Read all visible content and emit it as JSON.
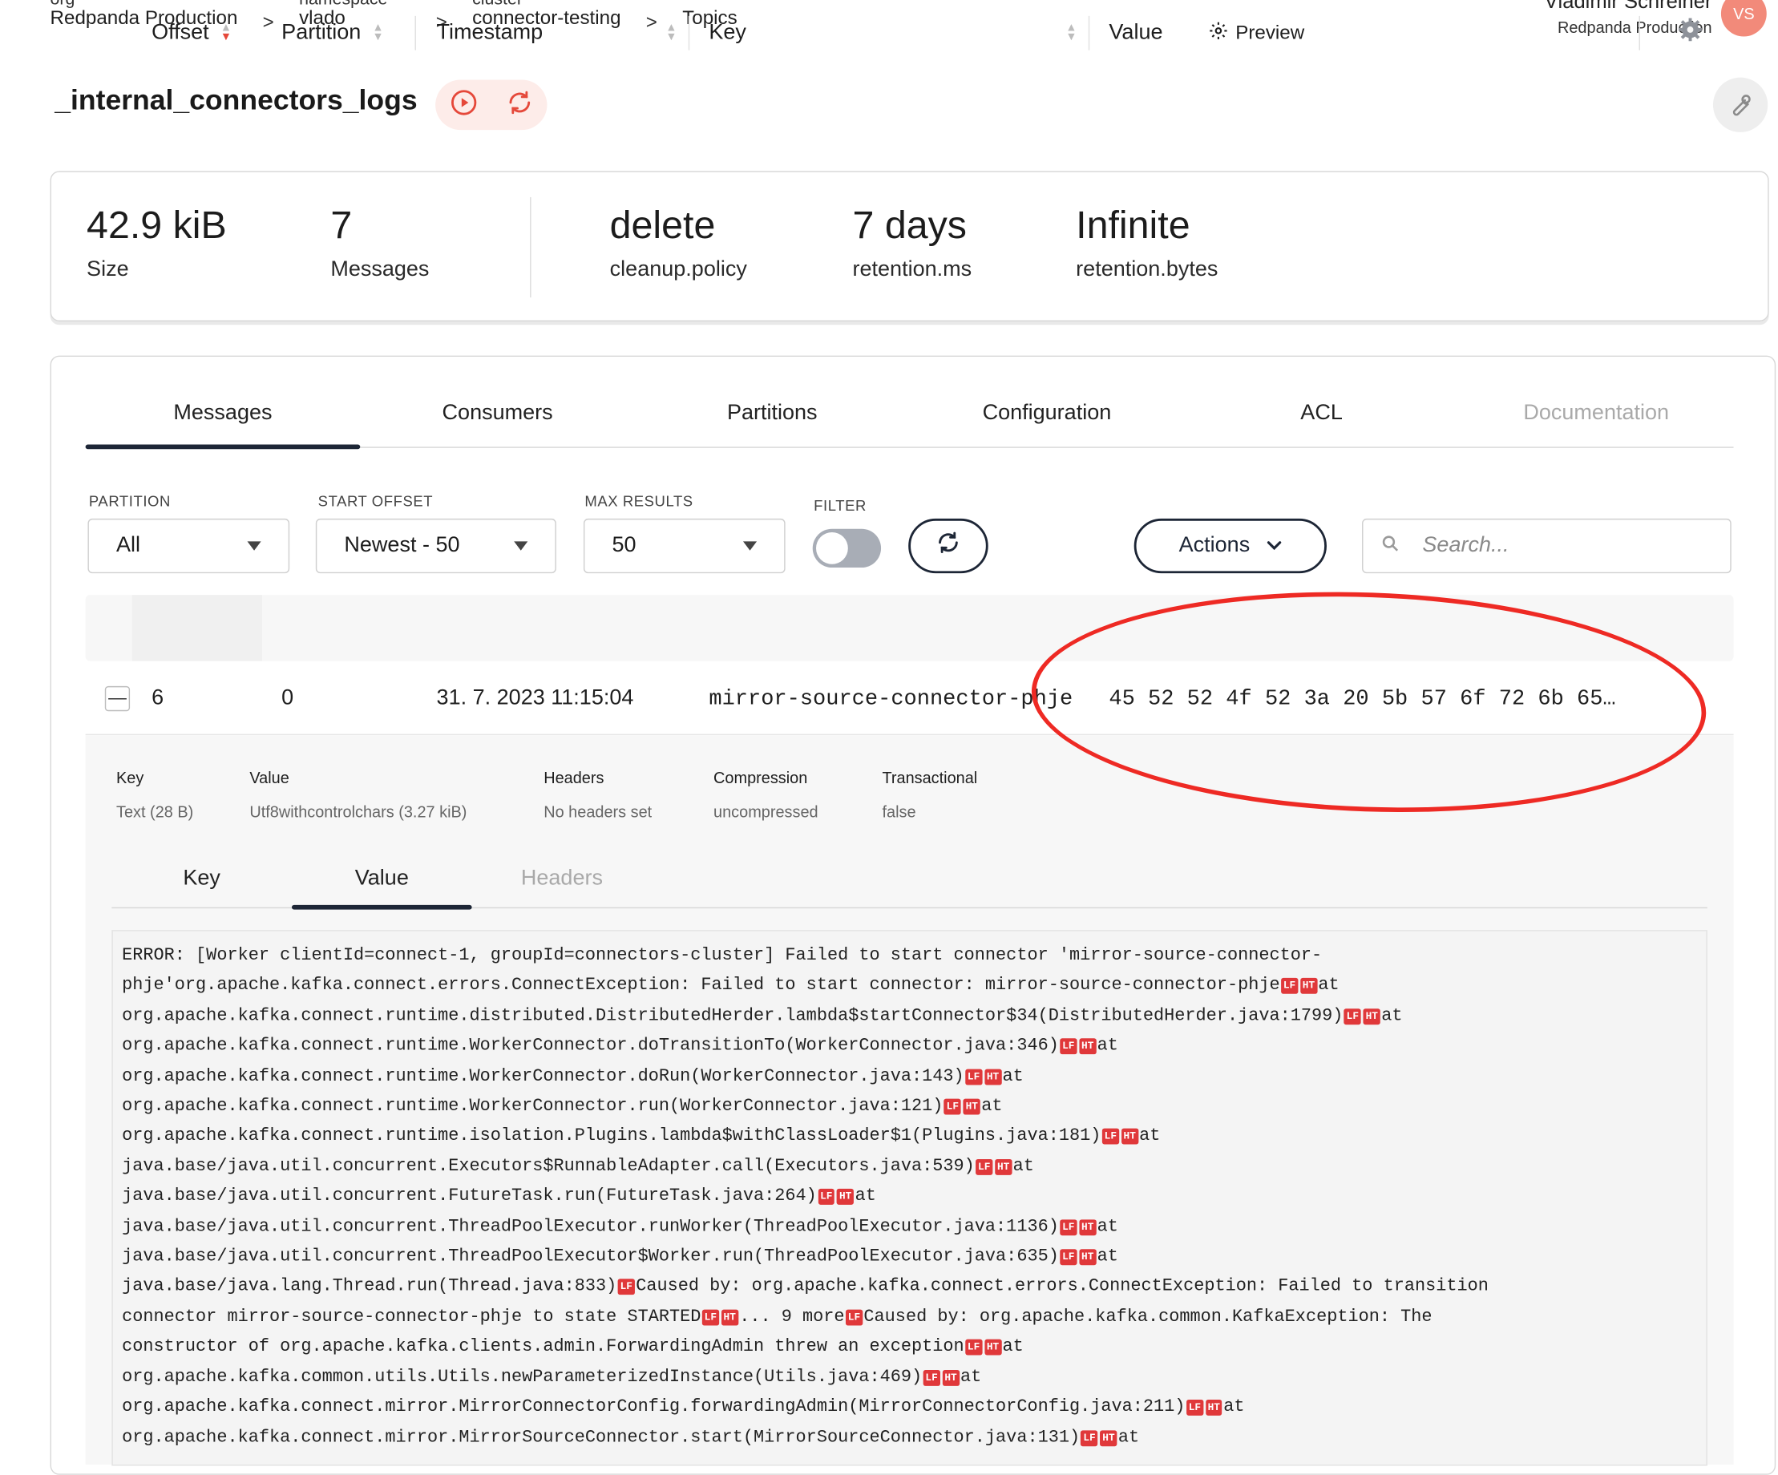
{
  "breadcrumb": [
    {
      "label": "org",
      "value": "Redpanda Production"
    },
    {
      "label": "namespace",
      "value": "vlado"
    },
    {
      "label": "cluster",
      "value": "connector-testing"
    },
    {
      "label": "",
      "value": "Topics"
    }
  ],
  "breadcrumb_separator": ">",
  "user": {
    "name": "Vladimir Schreiner",
    "org": "Redpanda Production",
    "initials": "VS"
  },
  "topic": {
    "title": "_internal_connectors_logs"
  },
  "icons": {
    "play": "play-circle-icon",
    "refresh": "refresh-icon",
    "wrench": "wrench-icon",
    "search": "search-icon",
    "gear": "gear-icon",
    "caret": "caret-down-icon"
  },
  "stats": [
    {
      "value": "42.9 kiB",
      "caption": "Size"
    },
    {
      "value": "7",
      "caption": "Messages"
    },
    {
      "value": "delete",
      "caption": "cleanup.policy"
    },
    {
      "value": "7 days",
      "caption": "retention.ms"
    },
    {
      "value": "Infinite",
      "caption": "retention.bytes"
    }
  ],
  "tabs": [
    "Messages",
    "Consumers",
    "Partitions",
    "Configuration",
    "ACL",
    "Documentation"
  ],
  "filters": {
    "partition": {
      "label": "PARTITION",
      "value": "All"
    },
    "start_offset": {
      "label": "START OFFSET",
      "value": "Newest - 50"
    },
    "max_results": {
      "label": "MAX RESULTS",
      "value": "50"
    },
    "filter": {
      "label": "FILTER"
    },
    "actions_label": "Actions",
    "search_placeholder": "Search..."
  },
  "table": {
    "headers": [
      "Offset",
      "Partition",
      "Timestamp",
      "Key",
      "Value"
    ],
    "preview_label": "Preview",
    "row": {
      "offset": "6",
      "partition": "0",
      "timestamp": "31. 7. 2023 11:15:04",
      "key": "mirror-source-connector-phje",
      "value": "45 52 52 4f 52 3a 20 5b 57 6f 72 6b 65…"
    }
  },
  "message_meta": [
    {
      "label": "Key",
      "value": "Text (28 B)"
    },
    {
      "label": "Value",
      "value": "Utf8withcontrolchars (3.27 kiB)"
    },
    {
      "label": "Headers",
      "value": "No headers set"
    },
    {
      "label": "Compression",
      "value": "uncompressed"
    },
    {
      "label": "Transactional",
      "value": "false"
    }
  ],
  "subtabs": [
    "Key",
    "Value",
    "Headers"
  ],
  "control_chars": {
    "lf": "LF",
    "ht": "HT"
  },
  "value_lines": [
    [
      [
        "t",
        "ERROR: [Worker clientId=connect-1, groupId=connectors-cluster] Failed to start connector 'mirror-source-connector-"
      ]
    ],
    [
      [
        "t",
        "phje'org.apache.kafka.connect.errors.ConnectException: Failed to start connector: mirror-source-connector-phje"
      ],
      [
        "c",
        "LF"
      ],
      [
        "c",
        "HT"
      ],
      [
        "t",
        "at"
      ]
    ],
    [
      [
        "t",
        "org.apache.kafka.connect.runtime.distributed.DistributedHerder.lambda$startConnector$34(DistributedHerder.java:1799)"
      ],
      [
        "c",
        "LF"
      ],
      [
        "c",
        "HT"
      ],
      [
        "t",
        "at"
      ]
    ],
    [
      [
        "t",
        "org.apache.kafka.connect.runtime.WorkerConnector.doTransitionTo(WorkerConnector.java:346)"
      ],
      [
        "c",
        "LF"
      ],
      [
        "c",
        "HT"
      ],
      [
        "t",
        "at"
      ]
    ],
    [
      [
        "t",
        "org.apache.kafka.connect.runtime.WorkerConnector.doRun(WorkerConnector.java:143)"
      ],
      [
        "c",
        "LF"
      ],
      [
        "c",
        "HT"
      ],
      [
        "t",
        "at"
      ]
    ],
    [
      [
        "t",
        "org.apache.kafka.connect.runtime.WorkerConnector.run(WorkerConnector.java:121)"
      ],
      [
        "c",
        "LF"
      ],
      [
        "c",
        "HT"
      ],
      [
        "t",
        "at"
      ]
    ],
    [
      [
        "t",
        "org.apache.kafka.connect.runtime.isolation.Plugins.lambda$withClassLoader$1(Plugins.java:181)"
      ],
      [
        "c",
        "LF"
      ],
      [
        "c",
        "HT"
      ],
      [
        "t",
        "at"
      ]
    ],
    [
      [
        "t",
        "java.base/java.util.concurrent.Executors$RunnableAdapter.call(Executors.java:539)"
      ],
      [
        "c",
        "LF"
      ],
      [
        "c",
        "HT"
      ],
      [
        "t",
        "at"
      ]
    ],
    [
      [
        "t",
        "java.base/java.util.concurrent.FutureTask.run(FutureTask.java:264)"
      ],
      [
        "c",
        "LF"
      ],
      [
        "c",
        "HT"
      ],
      [
        "t",
        "at"
      ]
    ],
    [
      [
        "t",
        "java.base/java.util.concurrent.ThreadPoolExecutor.runWorker(ThreadPoolExecutor.java:1136)"
      ],
      [
        "c",
        "LF"
      ],
      [
        "c",
        "HT"
      ],
      [
        "t",
        "at"
      ]
    ],
    [
      [
        "t",
        "java.base/java.util.concurrent.ThreadPoolExecutor$Worker.run(ThreadPoolExecutor.java:635)"
      ],
      [
        "c",
        "LF"
      ],
      [
        "c",
        "HT"
      ],
      [
        "t",
        "at"
      ]
    ],
    [
      [
        "t",
        "java.base/java.lang.Thread.run(Thread.java:833)"
      ],
      [
        "c",
        "LF"
      ],
      [
        "t",
        "Caused by: org.apache.kafka.connect.errors.ConnectException: Failed to transition"
      ]
    ],
    [
      [
        "t",
        "connector mirror-source-connector-phje to state STARTED"
      ],
      [
        "c",
        "LF"
      ],
      [
        "c",
        "HT"
      ],
      [
        "t",
        "... 9 more"
      ],
      [
        "c",
        "LF"
      ],
      [
        "t",
        "Caused by: org.apache.kafka.common.KafkaException: The"
      ]
    ],
    [
      [
        "t",
        "constructor of org.apache.kafka.clients.admin.ForwardingAdmin threw an exception"
      ],
      [
        "c",
        "LF"
      ],
      [
        "c",
        "HT"
      ],
      [
        "t",
        "at"
      ]
    ],
    [
      [
        "t",
        "org.apache.kafka.common.utils.Utils.newParameterizedInstance(Utils.java:469)"
      ],
      [
        "c",
        "LF"
      ],
      [
        "c",
        "HT"
      ],
      [
        "t",
        "at"
      ]
    ],
    [
      [
        "t",
        "org.apache.kafka.connect.mirror.MirrorConnectorConfig.forwardingAdmin(MirrorConnectorConfig.java:211)"
      ],
      [
        "c",
        "LF"
      ],
      [
        "c",
        "HT"
      ],
      [
        "t",
        "at"
      ]
    ],
    [
      [
        "t",
        "org.apache.kafka.connect.mirror.MirrorSourceConnector.start(MirrorSourceConnector.java:131)"
      ],
      [
        "c",
        "LF"
      ],
      [
        "c",
        "HT"
      ],
      [
        "t",
        "at"
      ]
    ]
  ],
  "colors": {
    "accent": "#e5483a",
    "navy": "#1d2636",
    "annotation_ring": "#ee2a24"
  }
}
